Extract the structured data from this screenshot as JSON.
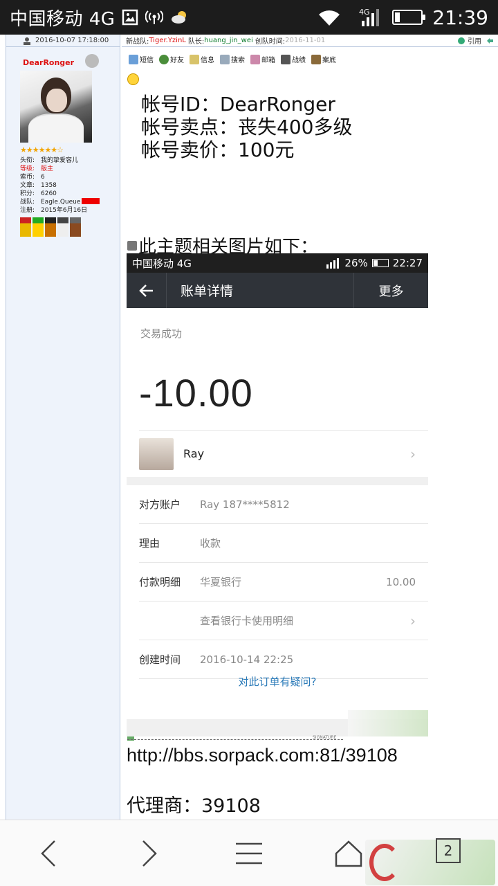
{
  "status_bar": {
    "carrier": "中国移动 4G",
    "network_label": "4G",
    "time": "21:39"
  },
  "post_header": {
    "datetime": "2016-10-07 17:18:00",
    "team_label": "新战队:",
    "team_name": "Tiger.YzinL",
    "leader_label": "队长:",
    "leader_name": "huang_jin_wei",
    "created_label": "创队时间:",
    "created_date": "2016-11-01",
    "quote_label": "引用"
  },
  "user": {
    "name": "DearRonger",
    "stars": "★★★★★★☆",
    "stats": [
      {
        "k": "头衔:",
        "v": "我的挚爱容儿",
        "red": false
      },
      {
        "k": "等级:",
        "v": "版主",
        "red": true
      },
      {
        "k": "索币:",
        "v": "6",
        "red": false
      },
      {
        "k": "文章:",
        "v": "1358",
        "red": false
      },
      {
        "k": "积分:",
        "v": "6260",
        "red": false
      },
      {
        "k": "战队:",
        "v": "Eagle.Queue",
        "red": false
      },
      {
        "k": "注册:",
        "v": "2015年6月16日",
        "red": false
      }
    ]
  },
  "toolbar": {
    "sms": "短信",
    "friend": "好友",
    "info": "信息",
    "search": "搜索",
    "mail": "邮箱",
    "record": "战绩",
    "case": "案底"
  },
  "post": {
    "line1": "帐号ID：DearRonger",
    "line2": "帐号卖点：丧失400多级",
    "line3": "帐号卖价：100元",
    "images_label": "此主题相关图片如下：",
    "signature_label": "SIGNATURE",
    "url": "http://bbs.sorpack.com:81/39108",
    "agent": "代理商：39108"
  },
  "screenshot": {
    "carrier": "中国移动 4G",
    "battery": "26%",
    "time": "22:27",
    "title": "账单详情",
    "more": "更多",
    "status": "交易成功",
    "amount": "-10.00",
    "payee": "Ray",
    "rows": {
      "account_k": "对方账户",
      "account_v": "Ray 187****5812",
      "reason_k": "理由",
      "reason_v": "收款",
      "pay_k": "付款明细",
      "pay_v": "华夏银行",
      "pay_amt": "10.00",
      "card_detail": "查看银行卡使用明细",
      "created_k": "创建时间",
      "created_v": "2016-10-14 22:25"
    },
    "question": "对此订单有疑问?"
  },
  "browser": {
    "tab_count": "2"
  },
  "colors": {
    "accent_red": "#d11111",
    "link_blue": "#2a7ab8",
    "nav_dark": "#2f3339"
  }
}
